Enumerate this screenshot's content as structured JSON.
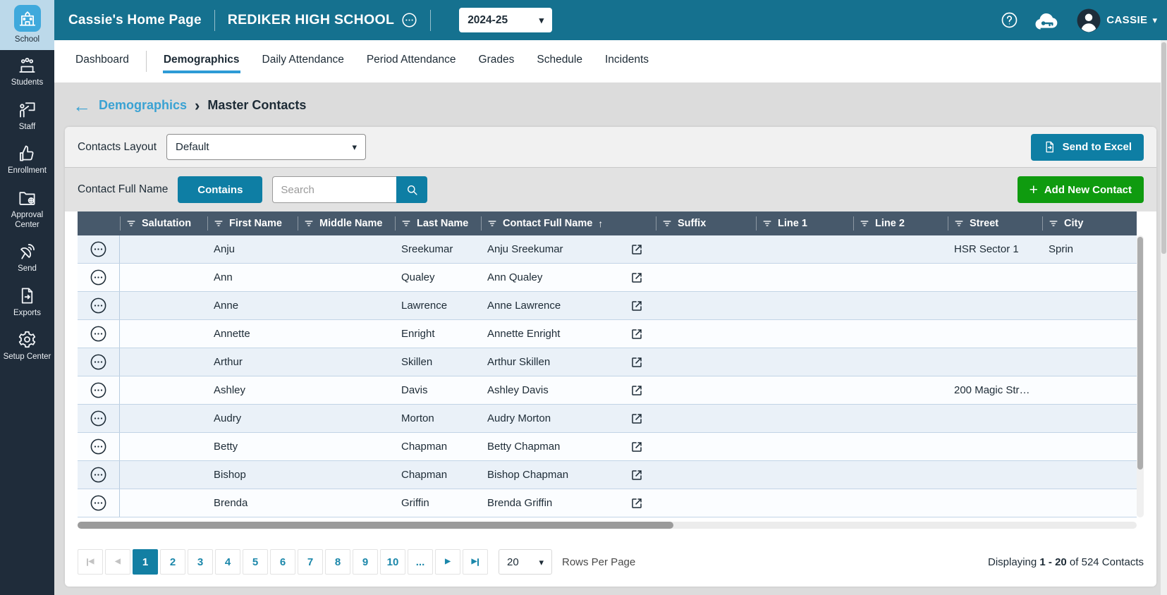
{
  "colors": {
    "header_teal": "#15718F",
    "button_teal": "#0E7EA4",
    "active_page_teal": "#137FA3",
    "add_button_green": "#0F9B0F",
    "sidebar_navy": "#1F2C3A",
    "sidebar_active_blue": "#BCD9EA",
    "sidebar_tile_blue": "#3FA9DC",
    "link_blue": "#3AA2D3",
    "tab_underline_blue": "#2E9BD6",
    "table_header_slate": "#47596B",
    "row_alt_blue": "#EAF1F8"
  },
  "header": {
    "home_label": "Cassie's Home Page",
    "school_name": "REDIKER HIGH SCHOOL",
    "year": "2024-25",
    "user_name": "CASSIE"
  },
  "sidebar": {
    "items": [
      {
        "label": "School",
        "icon": "school-icon",
        "active": true
      },
      {
        "label": "Students",
        "icon": "students-icon",
        "active": false
      },
      {
        "label": "Staff",
        "icon": "staff-icon",
        "active": false
      },
      {
        "label": "Enrollment",
        "icon": "enrollment-icon",
        "active": false
      },
      {
        "label": "Approval Center",
        "icon": "approval-center-icon",
        "active": false
      },
      {
        "label": "Send",
        "icon": "send-icon",
        "active": false
      },
      {
        "label": "Exports",
        "icon": "exports-icon",
        "active": false
      },
      {
        "label": "Setup Center",
        "icon": "setup-center-icon",
        "active": false
      }
    ]
  },
  "nav": {
    "tabs": [
      "Dashboard",
      "Demographics",
      "Daily Attendance",
      "Period Attendance",
      "Grades",
      "Schedule",
      "Incidents"
    ],
    "active": "Demographics"
  },
  "breadcrumb": {
    "back": "Demographics",
    "current": "Master Contacts"
  },
  "toolbar": {
    "layout_label": "Contacts Layout",
    "layout_value": "Default",
    "send_to_excel": "Send to Excel",
    "filter_field": "Contact Full Name",
    "operator": "Contains",
    "search_placeholder": "Search",
    "add_contact": "Add New Contact"
  },
  "table": {
    "columns": [
      "Salutation",
      "First Name",
      "Middle Name",
      "Last Name",
      "Contact Full Name",
      "Suffix",
      "Line 1",
      "Line 2",
      "Street",
      "City"
    ],
    "sort": {
      "column": "Contact Full Name",
      "direction": "asc",
      "arrow": "↑"
    },
    "rows": [
      {
        "salutation": "",
        "first_name": "Anju",
        "middle_name": "",
        "last_name": "Sreekumar",
        "full_name": "Anju Sreekumar",
        "suffix": "",
        "line1": "",
        "line2": "",
        "street": "HSR Sector 1",
        "city": "Sprin"
      },
      {
        "salutation": "",
        "first_name": "Ann",
        "middle_name": "",
        "last_name": "Qualey",
        "full_name": "Ann Qualey",
        "suffix": "",
        "line1": "",
        "line2": "",
        "street": "",
        "city": ""
      },
      {
        "salutation": "",
        "first_name": "Anne",
        "middle_name": "",
        "last_name": "Lawrence",
        "full_name": "Anne Lawrence",
        "suffix": "",
        "line1": "",
        "line2": "",
        "street": "",
        "city": ""
      },
      {
        "salutation": "",
        "first_name": "Annette",
        "middle_name": "",
        "last_name": "Enright",
        "full_name": "Annette Enright",
        "suffix": "",
        "line1": "",
        "line2": "",
        "street": "",
        "city": ""
      },
      {
        "salutation": "",
        "first_name": "Arthur",
        "middle_name": "",
        "last_name": "Skillen",
        "full_name": "Arthur Skillen",
        "suffix": "",
        "line1": "",
        "line2": "",
        "street": "",
        "city": ""
      },
      {
        "salutation": "",
        "first_name": "Ashley",
        "middle_name": "",
        "last_name": "Davis",
        "full_name": "Ashley Davis",
        "suffix": "",
        "line1": "",
        "line2": "",
        "street": "200 Magic Str…",
        "city": ""
      },
      {
        "salutation": "",
        "first_name": "Audry",
        "middle_name": "",
        "last_name": "Morton",
        "full_name": "Audry Morton",
        "suffix": "",
        "line1": "",
        "line2": "",
        "street": "",
        "city": ""
      },
      {
        "salutation": "",
        "first_name": "Betty",
        "middle_name": "",
        "last_name": "Chapman",
        "full_name": "Betty Chapman",
        "suffix": "",
        "line1": "",
        "line2": "",
        "street": "",
        "city": ""
      },
      {
        "salutation": "",
        "first_name": "Bishop",
        "middle_name": "",
        "last_name": "Chapman",
        "full_name": "Bishop Chapman",
        "suffix": "",
        "line1": "",
        "line2": "",
        "street": "",
        "city": ""
      },
      {
        "salutation": "",
        "first_name": "Brenda",
        "middle_name": "",
        "last_name": "Griffin",
        "full_name": "Brenda Griffin",
        "suffix": "",
        "line1": "",
        "line2": "",
        "street": "",
        "city": ""
      }
    ]
  },
  "pagination": {
    "pages": [
      "1",
      "2",
      "3",
      "4",
      "5",
      "6",
      "7",
      "8",
      "9",
      "10",
      "..."
    ],
    "active_page": "1",
    "first_enabled": false,
    "prev_enabled": false,
    "next_enabled": true,
    "last_enabled": true,
    "rows_per_page": "20",
    "rows_per_page_label": "Rows Per Page",
    "summary": {
      "prefix": "Displaying",
      "range": "1 - 20",
      "suffix": "of 524 Contacts"
    }
  }
}
